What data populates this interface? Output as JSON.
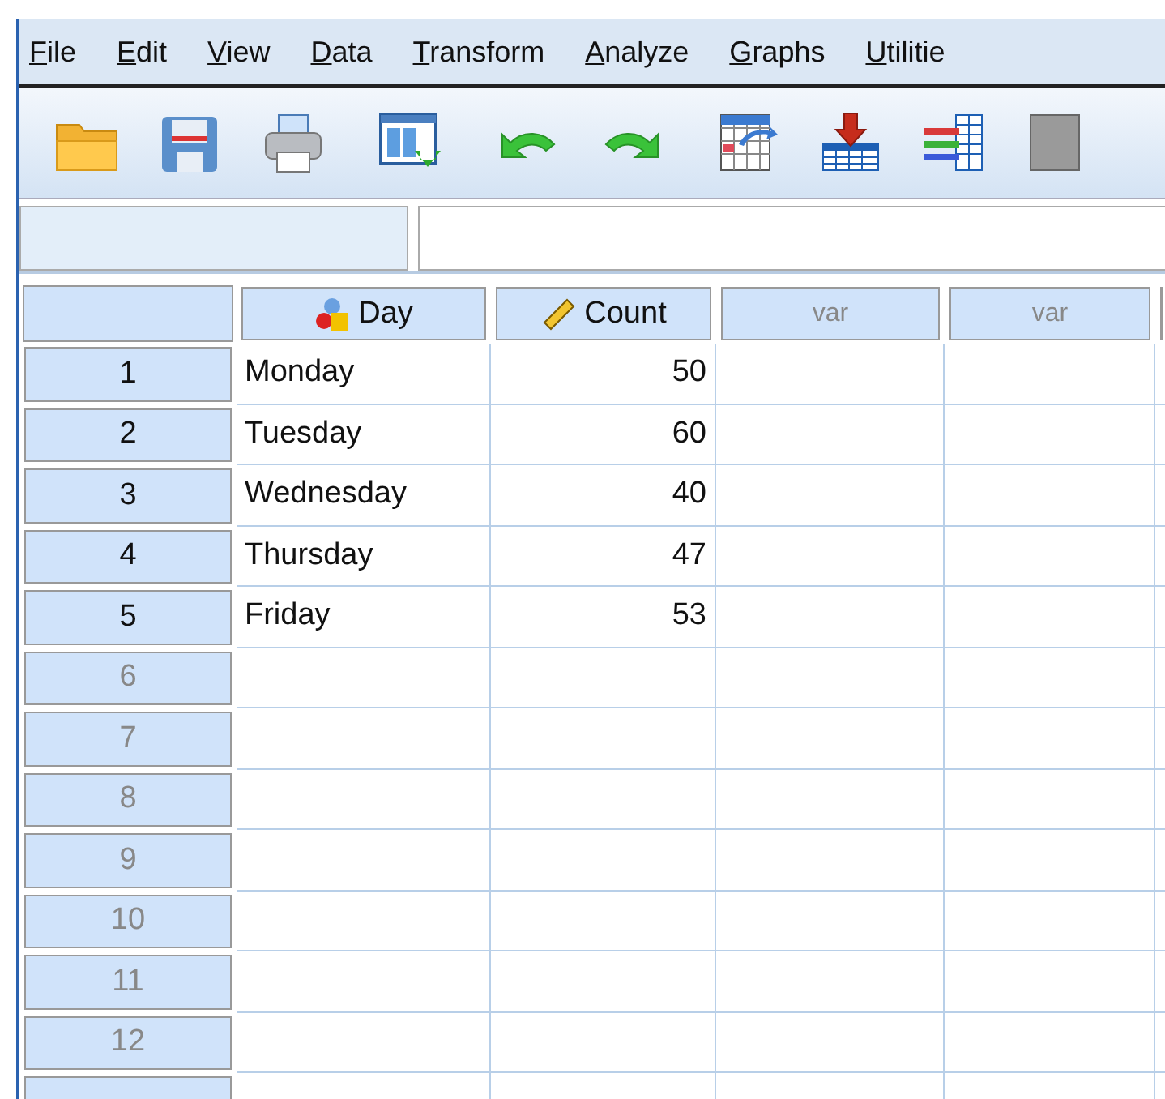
{
  "menu": [
    "File",
    "Edit",
    "View",
    "Data",
    "Transform",
    "Analyze",
    "Graphs",
    "Utilitie"
  ],
  "toolbar": [
    {
      "kind": "open"
    },
    {
      "kind": "save"
    },
    {
      "kind": "print"
    },
    {
      "kind": "dialog"
    },
    {
      "kind": "undo"
    },
    {
      "kind": "redo"
    },
    {
      "kind": "goto"
    },
    {
      "kind": "insert"
    },
    {
      "kind": "variables"
    },
    {
      "kind": "grid"
    }
  ],
  "columns": [
    {
      "label": "Day",
      "kind": "nominal"
    },
    {
      "label": "Count",
      "kind": "scale"
    },
    {
      "label": "var",
      "kind": "empty"
    },
    {
      "label": "var",
      "kind": "empty"
    }
  ],
  "rows": [
    {
      "number": "1",
      "empty": false,
      "cells": [
        "Monday",
        "50"
      ]
    },
    {
      "number": "2",
      "empty": false,
      "cells": [
        "Tuesday",
        "60"
      ]
    },
    {
      "number": "3",
      "empty": false,
      "cells": [
        "Wednesday",
        "40"
      ]
    },
    {
      "number": "4",
      "empty": false,
      "cells": [
        "Thursday",
        "47"
      ]
    },
    {
      "number": "5",
      "empty": false,
      "cells": [
        "Friday",
        "53"
      ]
    },
    {
      "number": "6",
      "empty": true,
      "cells": []
    },
    {
      "number": "7",
      "empty": true,
      "cells": []
    },
    {
      "number": "8",
      "empty": true,
      "cells": []
    },
    {
      "number": "9",
      "empty": true,
      "cells": []
    },
    {
      "number": "10",
      "empty": true,
      "cells": []
    },
    {
      "number": "11",
      "empty": true,
      "cells": []
    },
    {
      "number": "12",
      "empty": true,
      "cells": []
    }
  ]
}
